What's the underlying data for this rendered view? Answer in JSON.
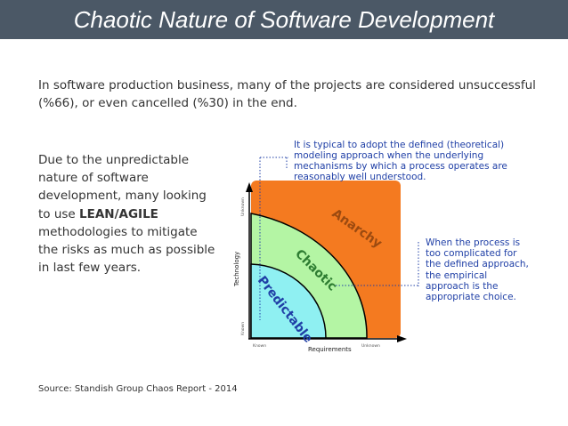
{
  "slide": {
    "title": "Chaotic Nature of Software Development",
    "intro": "In software production business, many of the projects are considered unsuccessful (%66), or even cancelled (%30) in the end.",
    "left_text_before": "Due to the unpredictable nature of software development, many looking to use ",
    "left_text_bold": "LEAN/AGILE",
    "left_text_after": " methodologies to mitigate the risks as much as possible in last few years.",
    "source": "Source: Standish Group Chaos Report - 2014"
  },
  "diagram": {
    "callout_top": "It is typical to adopt the defined (theoretical) modeling approach when the underlying mechanisms by which a process operates are reasonably well understood.",
    "callout_right": "When the process is too complicated for the defined approach, the empirical approach is the appropriate choice.",
    "zone_anarchy": "Anarchy",
    "zone_chaotic": "Chaotic",
    "zone_predictable": "Predictable",
    "axis_x": "Requirements",
    "axis_y": "Technology",
    "tick_known_x": "Known",
    "tick_unknown_x": "Unknown",
    "tick_known_y": "Known",
    "tick_unknown_y": "Unknown",
    "colors": {
      "anarchy": "#f47a20",
      "chaotic": "#b4f5a4",
      "predictable": "#8ff0f2",
      "callout_text": "#1f3fa6",
      "title_bar": "#4b5866"
    }
  }
}
